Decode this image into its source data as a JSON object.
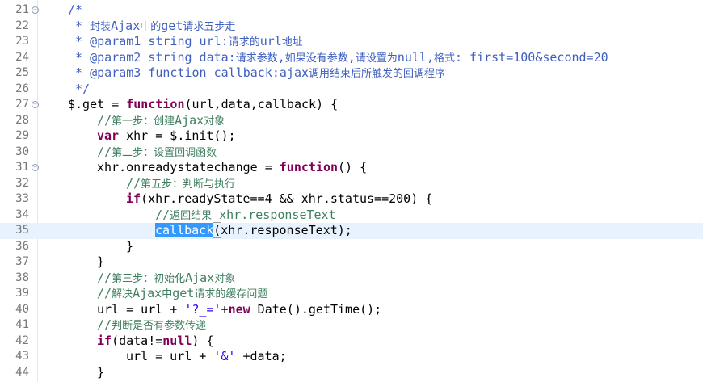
{
  "editor": {
    "lines": [
      {
        "no": "21",
        "fold": true,
        "indent": 0,
        "tokens": [
          {
            "t": "/*",
            "c": "c-doc"
          }
        ]
      },
      {
        "no": "22",
        "fold": false,
        "indent": 0,
        "tokens": [
          {
            "t": " * 封装Ajax中的get请求五步走",
            "c": "c-doc"
          }
        ]
      },
      {
        "no": "23",
        "fold": false,
        "indent": 0,
        "tokens": [
          {
            "t": " * @param1 string url:请求的url地址",
            "c": "c-doc"
          }
        ]
      },
      {
        "no": "24",
        "fold": false,
        "indent": 0,
        "tokens": [
          {
            "t": " * @param2 string data:请求参数,如果没有参数,请设置为null,格式: first=100&second=20",
            "c": "c-doc"
          }
        ]
      },
      {
        "no": "25",
        "fold": false,
        "indent": 0,
        "tokens": [
          {
            "t": " * @param3 function callback:ajax调用结束后所触发的回调程序",
            "c": "c-doc"
          }
        ]
      },
      {
        "no": "26",
        "fold": false,
        "indent": 0,
        "tokens": [
          {
            "t": " */",
            "c": "c-doc"
          }
        ]
      },
      {
        "no": "27",
        "fold": true,
        "indent": 0,
        "tokens": [
          {
            "t": "$.get = ",
            "c": ""
          },
          {
            "t": "function",
            "c": "c-kw"
          },
          {
            "t": "(url,data,callback) {",
            "c": ""
          }
        ]
      },
      {
        "no": "28",
        "fold": false,
        "indent": 1,
        "tokens": [
          {
            "t": "//第一步：创建Ajax对象",
            "c": "c-com"
          }
        ]
      },
      {
        "no": "29",
        "fold": false,
        "indent": 1,
        "tokens": [
          {
            "t": "var",
            "c": "c-kw"
          },
          {
            "t": " xhr = $.init();",
            "c": ""
          }
        ]
      },
      {
        "no": "30",
        "fold": false,
        "indent": 1,
        "tokens": [
          {
            "t": "//第二步：设置回调函数",
            "c": "c-com"
          }
        ]
      },
      {
        "no": "31",
        "fold": true,
        "indent": 1,
        "tokens": [
          {
            "t": "xhr.onreadystatechange = ",
            "c": ""
          },
          {
            "t": "function",
            "c": "c-kw"
          },
          {
            "t": "() {",
            "c": ""
          }
        ]
      },
      {
        "no": "32",
        "fold": false,
        "indent": 2,
        "tokens": [
          {
            "t": "//第五步：判断与执行",
            "c": "c-com"
          }
        ]
      },
      {
        "no": "33",
        "fold": false,
        "indent": 2,
        "tokens": [
          {
            "t": "if",
            "c": "c-kw"
          },
          {
            "t": "(xhr.readyState==4 && xhr.status==200) {",
            "c": ""
          }
        ]
      },
      {
        "no": "34",
        "fold": false,
        "indent": 3,
        "tokens": [
          {
            "t": "//返回结果 xhr.responseText",
            "c": "c-com"
          }
        ]
      },
      {
        "no": "35",
        "fold": false,
        "indent": 3,
        "current": true,
        "tokens": [
          {
            "t": "callback",
            "c": "c-sel"
          },
          {
            "t": "(",
            "c": "c-match"
          },
          {
            "t": "xhr.responseText);",
            "c": ""
          }
        ]
      },
      {
        "no": "36",
        "fold": false,
        "indent": 2,
        "tokens": [
          {
            "t": "}",
            "c": ""
          }
        ]
      },
      {
        "no": "37",
        "fold": false,
        "indent": 1,
        "tokens": [
          {
            "t": "}",
            "c": ""
          }
        ]
      },
      {
        "no": "38",
        "fold": false,
        "indent": 1,
        "tokens": [
          {
            "t": "//第三步：初始化Ajax对象",
            "c": "c-com"
          }
        ]
      },
      {
        "no": "39",
        "fold": false,
        "indent": 1,
        "tokens": [
          {
            "t": "//解决Ajax中get请求的缓存问题",
            "c": "c-com"
          }
        ]
      },
      {
        "no": "40",
        "fold": false,
        "indent": 1,
        "tokens": [
          {
            "t": "url = url + ",
            "c": ""
          },
          {
            "t": "'?_='",
            "c": "c-str"
          },
          {
            "t": "+",
            "c": ""
          },
          {
            "t": "new",
            "c": "c-kw"
          },
          {
            "t": " Date().getTime();",
            "c": ""
          }
        ]
      },
      {
        "no": "41",
        "fold": false,
        "indent": 1,
        "tokens": [
          {
            "t": "//判断是否有参数传递",
            "c": "c-com"
          }
        ]
      },
      {
        "no": "42",
        "fold": false,
        "indent": 1,
        "tokens": [
          {
            "t": "if",
            "c": "c-kw"
          },
          {
            "t": "(data!=",
            "c": ""
          },
          {
            "t": "null",
            "c": "c-kw"
          },
          {
            "t": ") {",
            "c": ""
          }
        ]
      },
      {
        "no": "43",
        "fold": false,
        "indent": 2,
        "tokens": [
          {
            "t": "url = url + ",
            "c": ""
          },
          {
            "t": "'&'",
            "c": "c-str"
          },
          {
            "t": " +data;",
            "c": ""
          }
        ]
      },
      {
        "no": "44",
        "fold": false,
        "indent": 1,
        "tokens": [
          {
            "t": "}",
            "c": ""
          }
        ]
      }
    ]
  }
}
